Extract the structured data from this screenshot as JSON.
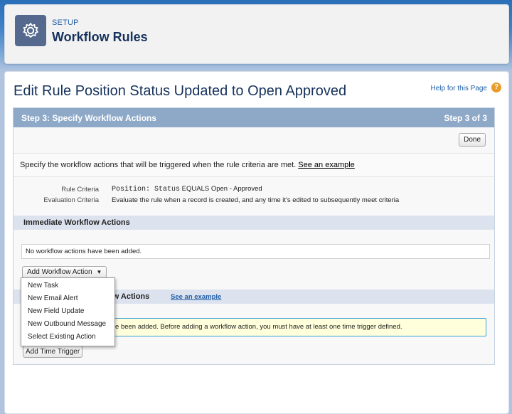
{
  "header": {
    "section": "SETUP",
    "title": "Workflow Rules"
  },
  "page": {
    "title": "Edit Rule Position Status Updated to Open Approved",
    "help_link": "Help for this Page",
    "help_icon": "?"
  },
  "wizard": {
    "step_title": "Step 3: Specify Workflow Actions",
    "step_count": "Step 3 of 3",
    "done_label": "Done",
    "description": "Specify the workflow actions that will be triggered when the rule criteria are met.",
    "example_link": "See an example",
    "rule_criteria_label": "Rule Criteria",
    "rule_criteria_prefix": "Position: Status",
    "rule_criteria_value": "EQUALS Open - Approved",
    "evaluation_label": "Evaluation Criteria",
    "evaluation_value": "Evaluate the rule when a record is created, and any time it's edited to subsequently meet criteria"
  },
  "immediate": {
    "heading": "Immediate Workflow Actions",
    "empty_text": "No workflow actions have been added.",
    "add_button": "Add Workflow Action",
    "caret": "▼"
  },
  "time_triggered": {
    "heading_visible": "ow Actions",
    "example_link": "See an example",
    "warning_visible": "ave been added. Before adding a workflow action, you must have at least one time trigger defined.",
    "add_button": "Add Time Trigger"
  },
  "menu": {
    "items": [
      "New Task",
      "New Email Alert",
      "New Field Update",
      "New Outbound Message",
      "Select Existing Action"
    ]
  },
  "colors": {
    "step_bar": "#8ea9c8",
    "section_header": "#dde3ee",
    "warning_bg": "#ffffdc",
    "accent": "#1f5ea8"
  }
}
